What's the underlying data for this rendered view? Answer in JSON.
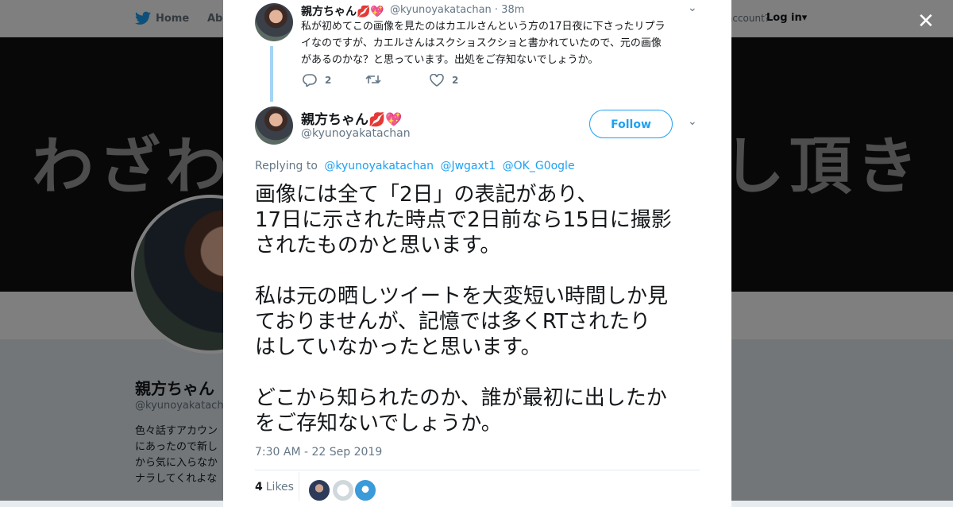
{
  "nav": {
    "home_label": "Home",
    "about_label": "Abo",
    "account_text": "account?",
    "login_label": "Log in"
  },
  "banner": {
    "left_text": "わざわ",
    "right_text": "し頂き"
  },
  "profile": {
    "name": "親方ちゃん",
    "handle": "@kyunoyakatachan",
    "bio_lines": [
      "色々話すアカウン",
      "にあったので新し",
      "から気に入らなか",
      "ナラしてくれよな"
    ]
  },
  "parent_tweet": {
    "name": "親方ちゃん💋💖",
    "handle": "@kyunoyakatachan",
    "time": "· 38m",
    "lines": [
      "私が初めてこの画像を見たのはカエルさんという方の17日夜に下さったリプラ",
      "イなのですが、カエルさんはスクショスクショと書かれていたので、元の画像",
      "があるのかな？と思っています。出処をご存知ないでしょうか。"
    ],
    "reply_count": "2",
    "retweet_count": "",
    "like_count": "2"
  },
  "main_tweet": {
    "name": "親方ちゃん💋💖",
    "handle": "@kyunoyakatachan",
    "follow_label": "Follow",
    "replying_prefix": "Replying to",
    "mentions": [
      "@kyunoyakatachan",
      "@Jwgaxt1",
      "@OK_G0ogle"
    ],
    "lines": [
      "画像には全て「2日」の表記があり、",
      "17日に示された時点で2日前なら15日に撮影",
      "されたものかと思います。",
      "",
      "私は元の晒しツイートを大変短い時間しか見",
      "ておりませんが、記憶では多くRTされたり",
      "はしていなかったと思います。",
      "",
      "どこから知られたのか、誰が最初に出したか",
      "をご存知ないでしょうか。"
    ],
    "timestamp": "7:30 AM - 22 Sep 2019",
    "likes_count": "4",
    "likes_label": "Likes"
  },
  "colors": {
    "accent": "#1da1f2",
    "thread_line": "#a3d4f5",
    "text": "#14171a",
    "muted": "#657786"
  },
  "icons": [
    "twitter-bird-icon",
    "close-icon",
    "chevron-down-icon",
    "reply-icon",
    "retweet-icon",
    "heart-icon"
  ]
}
